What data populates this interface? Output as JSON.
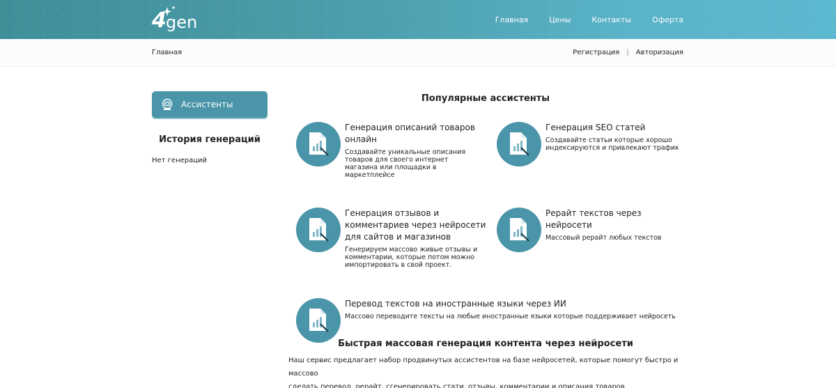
{
  "header": {
    "logo_text": "4gen",
    "nav": [
      "Главная",
      "Цены",
      "Контакты",
      "Оферта"
    ]
  },
  "subheader": {
    "breadcrumb": "Главная",
    "register": "Регистрация",
    "separator": "|",
    "login": "Авторизация"
  },
  "sidebar": {
    "assistants_button": "Ассистенты",
    "history_title": "История генераций",
    "history_empty": "Нет генераций"
  },
  "main": {
    "popular_title": "Популярные ассистенты",
    "cards": [
      {
        "title_lines": [
          "Генерация описаний товаров",
          "онлайн"
        ],
        "desc_lines": [
          "Создавайте уникальные описания",
          "товаров для своего интернет",
          "магазина или площадки в",
          "маркетплейсе"
        ]
      },
      {
        "title_lines": [
          "Генерация SEO статей"
        ],
        "desc_lines": [
          "Создавайте статьи которые хорошо",
          "индексируются и привлекают трафик"
        ]
      },
      {
        "title_lines": [
          "Генерация отзывов и",
          "комментариев через нейросети",
          "для сайтов и магазинов"
        ],
        "desc_lines": [
          "Генерируем массово живые отзывы и",
          "комментарии, которые потом можно",
          "импортировать в свой проект."
        ]
      },
      {
        "title_lines": [
          "Рерайт текстов через нейросети"
        ],
        "desc_lines": [
          "Массовый рерайт любых текстов"
        ]
      },
      {
        "title_lines": [
          "Перевод текстов на иностранные языки через ИИ"
        ],
        "desc_lines": [
          "Массово переводите тексты на любые иностранные языки которые поддерживает нейросеть"
        ]
      }
    ],
    "bottom_title": "Быстрая массовая генерация контента через нейросети",
    "bottom_text_lines": [
      "Наш сервис предлагает набор продвинутых ассистентов на базе нейросетей, которые помогут быстро и массово",
      "сделать перевод, рерайт, сгенерировать стати, отзывы, комментарии и описания товаров."
    ]
  },
  "colors": {
    "accent": "#4a95a9",
    "header_start": "#3f8e98",
    "header_end": "#5cb8cf"
  },
  "icons": [
    "logo-sparkle-icon",
    "assistant-robot-icon",
    "document-chart-icon"
  ]
}
